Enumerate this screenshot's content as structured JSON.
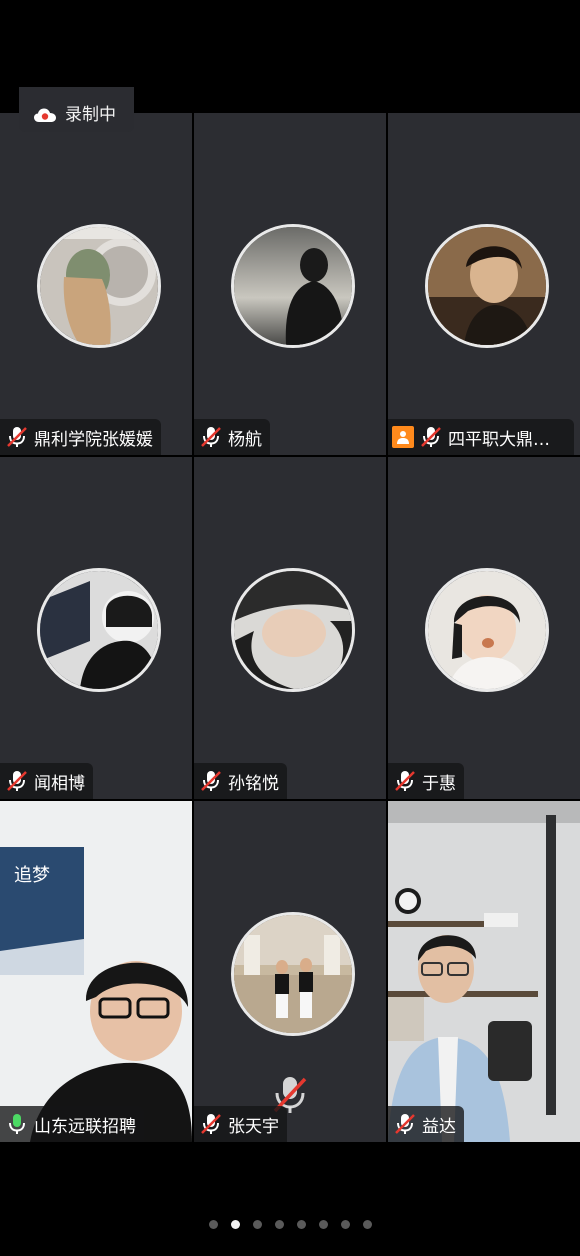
{
  "recording": {
    "label": "录制中",
    "icon": "cloud-record-icon"
  },
  "participants": [
    {
      "name": "鼎利学院张媛媛",
      "mic": "muted"
    },
    {
      "name": "杨航",
      "mic": "muted"
    },
    {
      "name": "四平职大鼎利...",
      "mic": "muted",
      "host": true
    },
    {
      "name": "闻相博",
      "mic": "muted"
    },
    {
      "name": "孙铭悦",
      "mic": "muted"
    },
    {
      "name": "于惠",
      "mic": "muted"
    },
    {
      "name": "山东远联招聘",
      "mic": "active",
      "video": true,
      "speaking": true
    },
    {
      "name": "张天宇",
      "mic": "muted"
    },
    {
      "name": "益达",
      "mic": "muted",
      "video": true
    }
  ],
  "pager": {
    "total": 8,
    "current": 2
  },
  "colors": {
    "speaking_border": "#4cd964",
    "muted_red": "#e5382f",
    "host_orange": "#ff8a1c",
    "tile_bg": "#2c2d32"
  }
}
